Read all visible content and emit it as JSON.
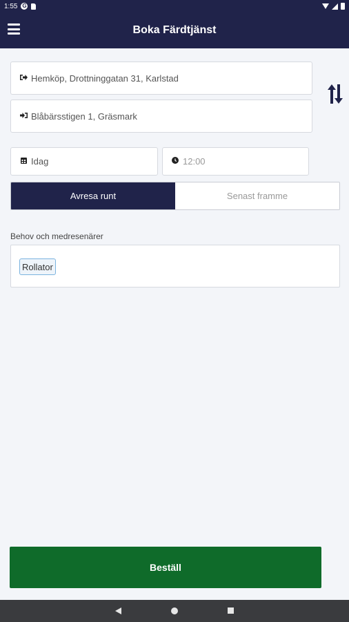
{
  "status_bar": {
    "time": "1:55",
    "g_badge": "G"
  },
  "app_bar": {
    "title": "Boka Färdtjänst"
  },
  "trip": {
    "from": "Hemköp, Drottninggatan 31, Karlstad",
    "to": "Blåbärsstigen 1, Gräsmark"
  },
  "schedule": {
    "date": "Idag",
    "time_placeholder": "12:00"
  },
  "mode_toggle": {
    "departure_label": "Avresa runt",
    "arrival_label": "Senast framme",
    "selected": "Avresa runt"
  },
  "needs": {
    "label": "Behov och medresenärer",
    "items": [
      "Rollator"
    ]
  },
  "actions": {
    "order_label": "Beställ"
  },
  "icons": {
    "menu": "menu-icon",
    "from": "sign-out-icon",
    "to": "sign-in-icon",
    "date": "calendar-icon",
    "time": "clock-icon",
    "swap": "swap-vertical-icon"
  },
  "colors": {
    "primary": "#20234a",
    "accent_green": "#0f6b2a",
    "background": "#f3f5f9",
    "chip_border": "#7ab3df"
  }
}
